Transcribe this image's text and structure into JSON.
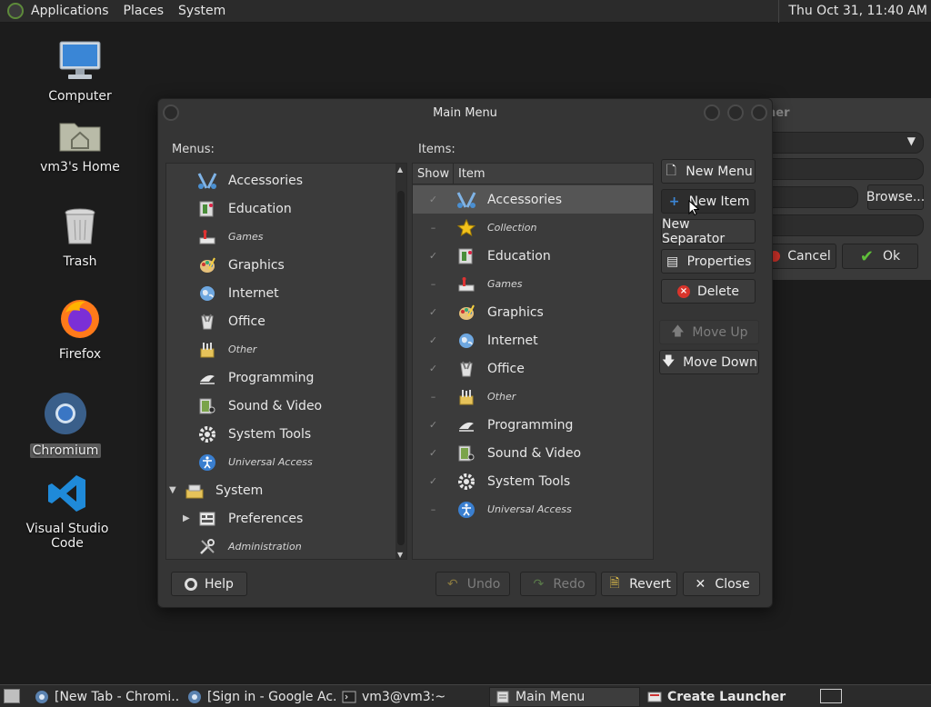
{
  "top_panel": {
    "menus": [
      "Applications",
      "Places",
      "System"
    ],
    "clock": "Thu Oct 31, 11:40 AM"
  },
  "desktop": {
    "icons": [
      {
        "label": "Computer",
        "icon": "computer-icon"
      },
      {
        "label": "vm3's Home",
        "icon": "home-folder-icon"
      },
      {
        "label": "Trash",
        "icon": "trash-icon"
      },
      {
        "label": "Firefox",
        "icon": "firefox-icon"
      },
      {
        "label": "Chromium",
        "icon": "chromium-icon",
        "selected": true
      },
      {
        "label": "Visual Studio Code",
        "icon": "vscode-icon"
      }
    ]
  },
  "launcher": {
    "title_fragment": "her",
    "browse_label": "Browse...",
    "cancel_label": "Cancel",
    "ok_label": "Ok"
  },
  "dialog": {
    "title": "Main Menu",
    "menus_label": "Menus:",
    "items_label": "Items:",
    "menus": [
      {
        "label": "Accessories",
        "icon": "accessories-icon",
        "italic": false,
        "indent": 1
      },
      {
        "label": "Education",
        "icon": "education-icon",
        "italic": false,
        "indent": 1
      },
      {
        "label": "Games",
        "icon": "games-icon",
        "italic": true,
        "indent": 1
      },
      {
        "label": "Graphics",
        "icon": "graphics-icon",
        "italic": false,
        "indent": 1
      },
      {
        "label": "Internet",
        "icon": "internet-icon",
        "italic": false,
        "indent": 1
      },
      {
        "label": "Office",
        "icon": "office-icon",
        "italic": false,
        "indent": 1
      },
      {
        "label": "Other",
        "icon": "other-icon",
        "italic": true,
        "indent": 1
      },
      {
        "label": "Programming",
        "icon": "programming-icon",
        "italic": false,
        "indent": 1
      },
      {
        "label": "Sound & Video",
        "icon": "sound-video-icon",
        "italic": false,
        "indent": 1
      },
      {
        "label": "System Tools",
        "icon": "system-tools-icon",
        "italic": false,
        "indent": 1
      },
      {
        "label": "Universal Access",
        "icon": "universal-access-icon",
        "italic": true,
        "indent": 1
      },
      {
        "label": "System",
        "icon": "system-icon",
        "italic": false,
        "indent": 0,
        "expanded": true
      },
      {
        "label": "Preferences",
        "icon": "preferences-icon",
        "italic": false,
        "indent": 1,
        "collapsed": true
      },
      {
        "label": "Administration",
        "icon": "administration-icon",
        "italic": true,
        "indent": 1
      }
    ],
    "columns": {
      "show": "Show",
      "item": "Item"
    },
    "items": [
      {
        "label": "Accessories",
        "icon": "accessories-icon",
        "italic": false,
        "checked": true,
        "selected": true
      },
      {
        "label": "Collection",
        "icon": "star-icon",
        "italic": true,
        "checked": false
      },
      {
        "label": "Education",
        "icon": "education-icon",
        "italic": false,
        "checked": true
      },
      {
        "label": "Games",
        "icon": "games-icon",
        "italic": true,
        "checked": false
      },
      {
        "label": "Graphics",
        "icon": "graphics-icon",
        "italic": false,
        "checked": true
      },
      {
        "label": "Internet",
        "icon": "internet-icon",
        "italic": false,
        "checked": true
      },
      {
        "label": "Office",
        "icon": "office-icon",
        "italic": false,
        "checked": true
      },
      {
        "label": "Other",
        "icon": "other-icon",
        "italic": true,
        "checked": false
      },
      {
        "label": "Programming",
        "icon": "programming-icon",
        "italic": false,
        "checked": true
      },
      {
        "label": "Sound & Video",
        "icon": "sound-video-icon",
        "italic": false,
        "checked": true
      },
      {
        "label": "System Tools",
        "icon": "system-tools-icon",
        "italic": false,
        "checked": true
      },
      {
        "label": "Universal Access",
        "icon": "universal-access-icon",
        "italic": true,
        "checked": false
      }
    ],
    "buttons": {
      "new_menu": "New Menu",
      "new_item": "New Item",
      "new_separator": "New Separator",
      "properties": "Properties",
      "delete": "Delete",
      "move_up": "Move Up",
      "move_down": "Move Down",
      "help": "Help",
      "undo": "Undo",
      "redo": "Redo",
      "revert": "Revert",
      "close": "Close"
    }
  },
  "taskbar": {
    "tasks": [
      {
        "label": "[New Tab - Chromi...",
        "icon": "chromium-icon"
      },
      {
        "label": "[Sign in - Google Ac...",
        "icon": "chromium-icon"
      },
      {
        "label": "vm3@vm3:~",
        "icon": "terminal-icon"
      },
      {
        "label": "Main Menu",
        "icon": "menu-editor-icon",
        "active": true
      },
      {
        "label": "Create Launcher",
        "icon": "launcher-icon",
        "bold": true
      }
    ]
  },
  "colors": {
    "desktop_bg": "#1c1c1c",
    "panel_bg": "#2b2b2b",
    "dialog_bg": "#353535",
    "selection": "#5a5a5a",
    "accent_blue": "#2e7bd6",
    "delete_red": "#d9342b",
    "ok_green": "#5fbf3a"
  }
}
